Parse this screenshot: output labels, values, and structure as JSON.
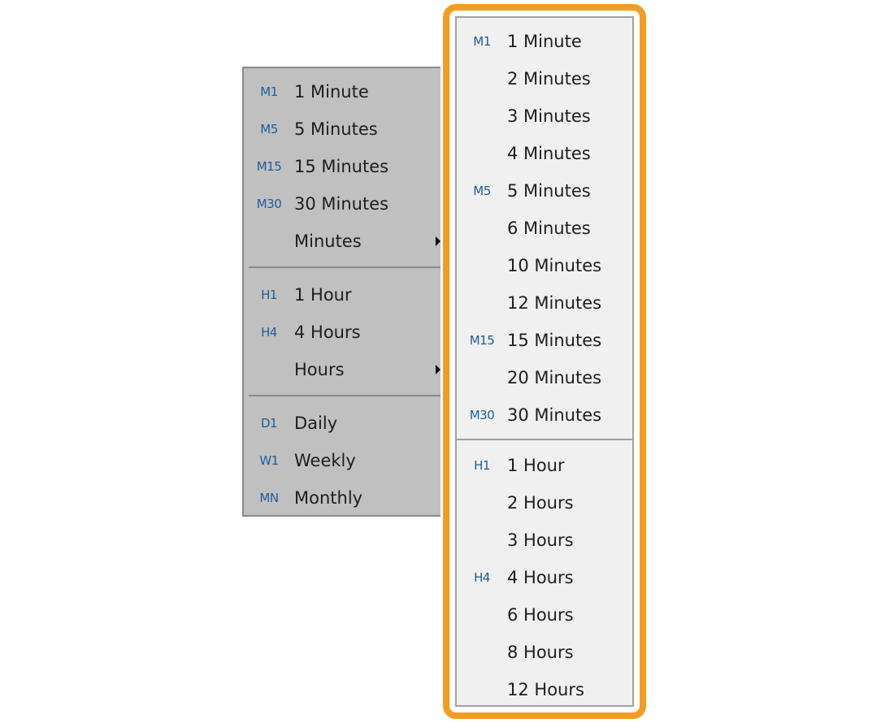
{
  "left_menu": {
    "groups": [
      {
        "items": [
          {
            "code": "M1",
            "label": "1 Minute"
          },
          {
            "code": "M5",
            "label": "5 Minutes"
          },
          {
            "code": "M15",
            "label": "15 Minutes"
          },
          {
            "code": "M30",
            "label": "30 Minutes"
          },
          {
            "code": "",
            "label": "Minutes",
            "submenu": true
          }
        ]
      },
      {
        "items": [
          {
            "code": "H1",
            "label": "1 Hour"
          },
          {
            "code": "H4",
            "label": "4 Hours"
          },
          {
            "code": "",
            "label": "Hours",
            "submenu": true
          }
        ]
      },
      {
        "items": [
          {
            "code": "D1",
            "label": "Daily"
          },
          {
            "code": "W1",
            "label": "Weekly"
          },
          {
            "code": "MN",
            "label": "Monthly"
          }
        ]
      }
    ]
  },
  "right_menu": {
    "highlight_color": "#f39c22",
    "groups": [
      {
        "items": [
          {
            "code": "M1",
            "label": "1 Minute"
          },
          {
            "code": "",
            "label": "2 Minutes"
          },
          {
            "code": "",
            "label": "3 Minutes"
          },
          {
            "code": "",
            "label": "4 Minutes"
          },
          {
            "code": "M5",
            "label": "5 Minutes"
          },
          {
            "code": "",
            "label": "6 Minutes"
          },
          {
            "code": "",
            "label": "10 Minutes"
          },
          {
            "code": "",
            "label": "12 Minutes"
          },
          {
            "code": "M15",
            "label": "15 Minutes"
          },
          {
            "code": "",
            "label": "20 Minutes"
          },
          {
            "code": "M30",
            "label": "30 Minutes"
          }
        ]
      },
      {
        "items": [
          {
            "code": "H1",
            "label": "1 Hour"
          },
          {
            "code": "",
            "label": "2 Hours"
          },
          {
            "code": "",
            "label": "3 Hours"
          },
          {
            "code": "H4",
            "label": "4 Hours"
          },
          {
            "code": "",
            "label": "6 Hours"
          },
          {
            "code": "",
            "label": "8 Hours"
          },
          {
            "code": "",
            "label": "12 Hours"
          }
        ]
      }
    ]
  }
}
